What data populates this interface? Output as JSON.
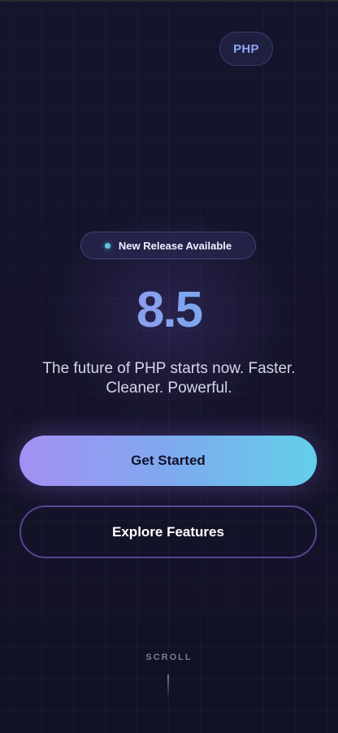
{
  "header": {
    "badge_label": "PHP"
  },
  "hero": {
    "release_label": "New Release Available",
    "version": "8.5",
    "tagline": "The future of PHP starts now. Faster. Cleaner. Powerful."
  },
  "actions": {
    "primary_label": "Get Started",
    "secondary_label": "Explore Features"
  },
  "footer": {
    "scroll_label": "SCROLL"
  },
  "colors": {
    "background": "#14142a",
    "accent_start": "#a58ff3",
    "accent_end": "#62cfea",
    "status_dot": "#5fc0de",
    "badge_text": "#8fa6f5"
  }
}
